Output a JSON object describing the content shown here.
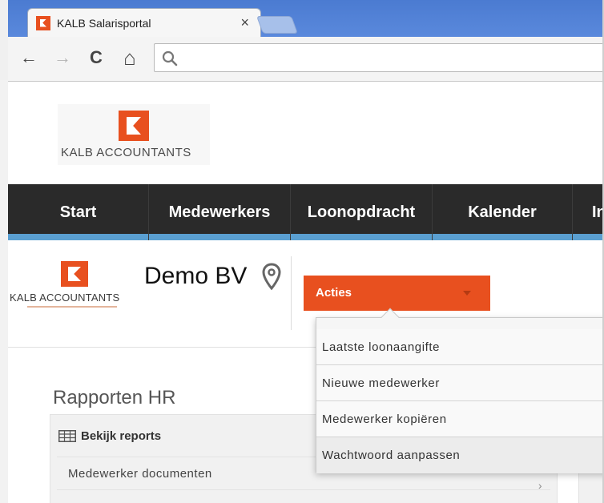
{
  "browser": {
    "tab_title": "KALB Salarisportal",
    "tab_close": "×",
    "back_glyph": "←",
    "forward_glyph": "→",
    "reload_glyph": "C",
    "home_glyph": "⌂",
    "url_value": "",
    "url_placeholder": ""
  },
  "header": {
    "logo_text": "KALB ACCOUNTANTS"
  },
  "nav": {
    "items": [
      "Start",
      "Medewerkers",
      "Loonopdracht",
      "Kalender",
      "In"
    ]
  },
  "company": {
    "logo_text": "KALB ACCOUNTANTS",
    "name": "Demo BV"
  },
  "actions": {
    "button_label": "Acties",
    "menu_items": [
      "Laatste loonaangifte",
      "Nieuwe medewerker",
      "Medewerker kopiëren",
      "Wachtwoord aanpassen"
    ]
  },
  "reports": {
    "title": "Rapporten HR",
    "panel_header": "Bekijk reports",
    "rows": [
      "Medewerker documenten"
    ],
    "row_chevron": "›"
  },
  "colors": {
    "accent": "#e8501f",
    "nav_bg": "#2a2a2a",
    "nav_underline": "#5a9fd1",
    "browser_blue": "#5a89dc"
  },
  "icons": {
    "favicon": "kalb-logo-icon",
    "search": "search-icon",
    "location": "map-pin-icon",
    "table": "table-icon",
    "caret": "caret-down-icon"
  }
}
